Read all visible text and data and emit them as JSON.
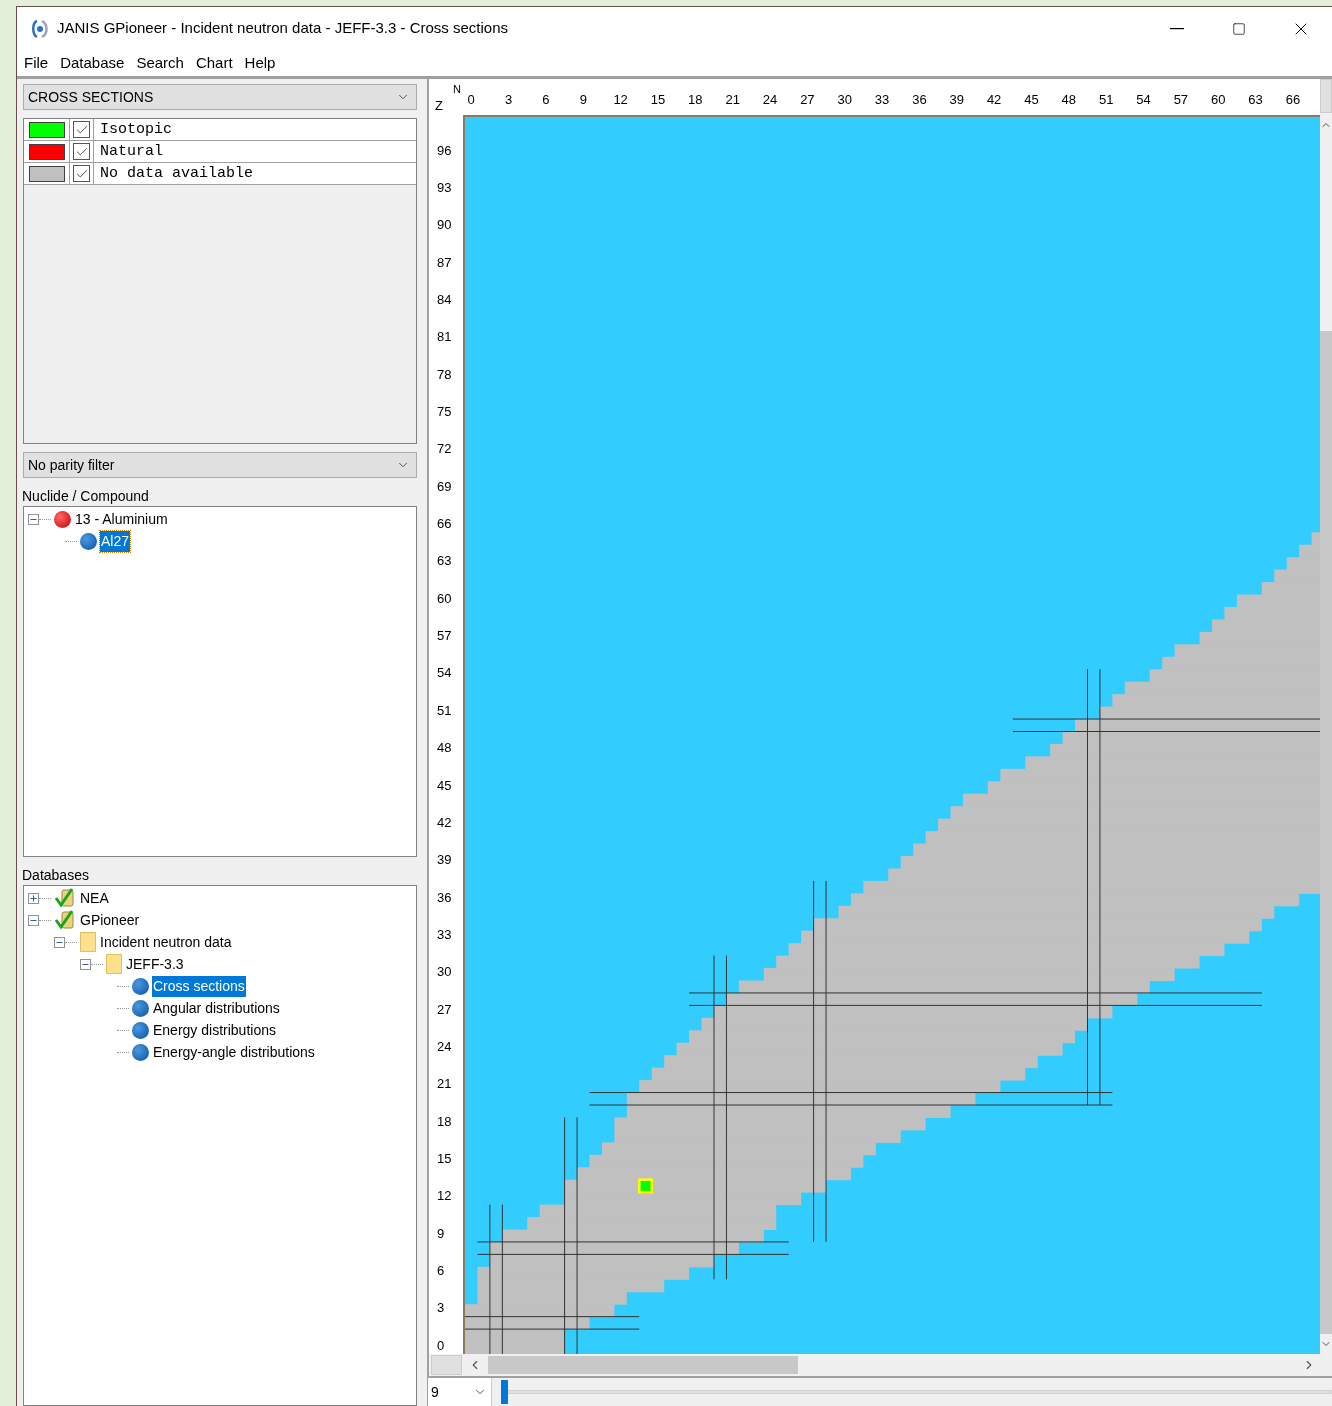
{
  "window": {
    "title": "JANIS GPioneer - Incident neutron data - JEFF-3.3 - Cross sections"
  },
  "menu": [
    "File",
    "Database",
    "Search",
    "Chart",
    "Help"
  ],
  "data_type": {
    "value": "CROSS SECTIONS"
  },
  "legend": [
    {
      "color": "#00ff00",
      "checked": true,
      "label": "Isotopic"
    },
    {
      "color": "#ff0000",
      "checked": true,
      "label": "Natural"
    },
    {
      "color": "#c0c0c0",
      "checked": true,
      "label": "No data available"
    }
  ],
  "parity_filter": {
    "value": "No parity filter"
  },
  "nuclide_tree": {
    "label": "Nuclide / Compound",
    "items": [
      {
        "label": "13 - Aluminium",
        "kind": "element",
        "expanded": true,
        "selected": false,
        "children": [
          {
            "label": "Al27",
            "kind": "nuclide",
            "selected": true
          }
        ]
      }
    ]
  },
  "databases": {
    "label": "Databases",
    "items": [
      {
        "label": "NEA",
        "kind": "database",
        "expanded": false,
        "selected": false
      },
      {
        "label": "GPioneer",
        "kind": "database",
        "expanded": true,
        "selected": false,
        "children": [
          {
            "label": "Incident neutron data",
            "kind": "folder",
            "expanded": true,
            "selected": false,
            "children": [
              {
                "label": "JEFF-3.3",
                "kind": "folder",
                "expanded": true,
                "selected": false,
                "children": [
                  {
                    "label": "Cross sections",
                    "kind": "leaf",
                    "selected": true
                  },
                  {
                    "label": "Angular distributions",
                    "kind": "leaf",
                    "selected": false
                  },
                  {
                    "label": "Energy distributions",
                    "kind": "leaf",
                    "selected": false
                  },
                  {
                    "label": "Energy-angle distributions",
                    "kind": "leaf",
                    "selected": false
                  }
                ]
              }
            ]
          }
        ]
      }
    ]
  },
  "chart": {
    "n_label": "N",
    "z_label": "Z",
    "n_ticks": [
      "0",
      "3",
      "6",
      "9",
      "12",
      "15",
      "18",
      "21",
      "24",
      "27",
      "30",
      "33",
      "36",
      "39",
      "42",
      "45",
      "48",
      "51",
      "54",
      "57",
      "60",
      "63",
      "66"
    ],
    "z_ticks": [
      "96",
      "93",
      "90",
      "87",
      "84",
      "81",
      "78",
      "75",
      "72",
      "69",
      "66",
      "63",
      "60",
      "57",
      "54",
      "51",
      "48",
      "45",
      "42",
      "39",
      "36",
      "33",
      "30",
      "27",
      "24",
      "21",
      "18",
      "15",
      "12",
      "9",
      "6",
      "3",
      "0"
    ]
  },
  "zoom": {
    "value": "9"
  },
  "slider": {
    "level": 0
  }
}
